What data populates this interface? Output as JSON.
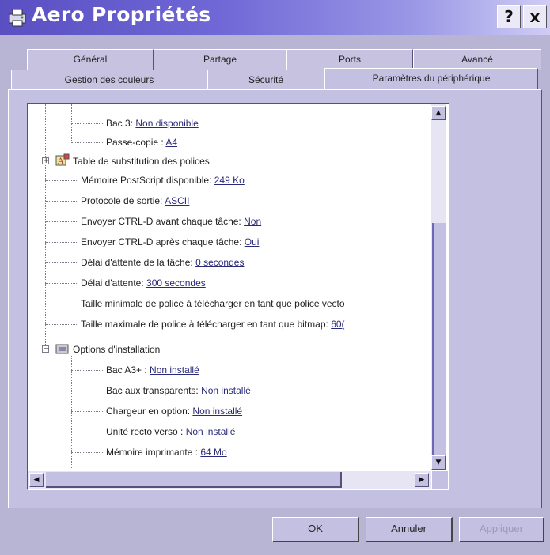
{
  "window": {
    "title": "Aero Propriétés",
    "help_button": "?",
    "close_button": "x"
  },
  "tabs": {
    "row1": [
      {
        "label": "Général"
      },
      {
        "label": "Partage"
      },
      {
        "label": "Ports"
      },
      {
        "label": "Avancé"
      }
    ],
    "row2": [
      {
        "label": "Gestion des couleurs"
      },
      {
        "label": "Sécurité"
      },
      {
        "label": "Paramètres du périphérique",
        "active": true
      }
    ]
  },
  "tree": {
    "items": [
      {
        "label": "Bac 3: ",
        "value": "Non disponible"
      },
      {
        "label": "Passe-copie : ",
        "value": "A4"
      },
      {
        "label": "Table de substitution des polices",
        "value": ""
      },
      {
        "label": "Mémoire PostScript disponible: ",
        "value": "249 Ko"
      },
      {
        "label": "Protocole de sortie: ",
        "value": "ASCII"
      },
      {
        "label": "Envoyer CTRL-D avant chaque tâche: ",
        "value": "Non"
      },
      {
        "label": "Envoyer CTRL-D après chaque tâche: ",
        "value": "Oui"
      },
      {
        "label": "Délai d'attente de la tâche: ",
        "value": "0 secondes"
      },
      {
        "label": "Délai d'attente: ",
        "value": "300 secondes"
      },
      {
        "label": "Taille minimale de police à télécharger en tant que police vecto",
        "value": ""
      },
      {
        "label": "Taille maximale de police à télécharger en tant que bitmap: ",
        "value": "60("
      },
      {
        "label": "Options d'installation",
        "value": ""
      },
      {
        "label": "Bac A3+ : ",
        "value": "Non installé"
      },
      {
        "label": "Bac aux transparents: ",
        "value": "Non installé"
      },
      {
        "label": "Chargeur en option: ",
        "value": "Non installé"
      },
      {
        "label": "Unité recto verso : ",
        "value": "Non installé"
      },
      {
        "label": "Mémoire imprimante : ",
        "value": "64 Mo"
      }
    ],
    "expand_plus": "+",
    "expand_minus": "−"
  },
  "scroll": {
    "up": "▲",
    "down": "▼",
    "left": "◀",
    "right": "▶"
  },
  "buttons": {
    "ok": "OK",
    "cancel": "Annuler",
    "apply": "Appliquer"
  },
  "colors": {
    "title_gradient_start": "#5a4fc2",
    "window_face": "#c4c0e2",
    "link_text": "#2a2a7a"
  }
}
